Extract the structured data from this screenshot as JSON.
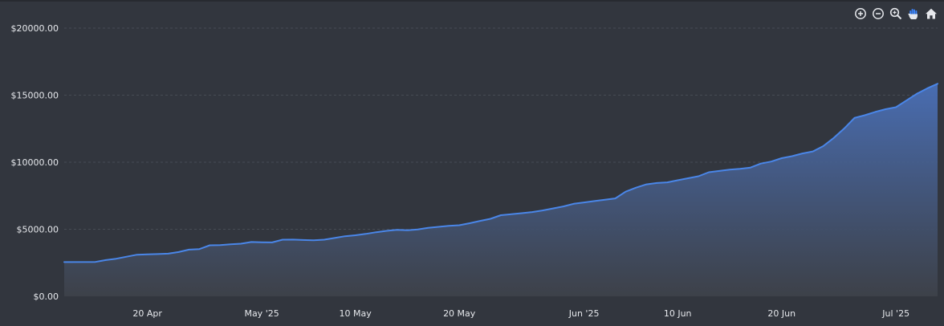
{
  "toolbar": {
    "icons": [
      "zoom-in-icon",
      "zoom-out-icon",
      "zoom-select-icon",
      "pan-hand-icon",
      "reset-home-icon"
    ]
  },
  "colors": {
    "background": "#32363e",
    "line": "#4a86e8",
    "grid": "#474c55",
    "text": "#e6e8ec",
    "active_tool": "#3b82f6"
  },
  "chart_data": {
    "type": "area",
    "title": "",
    "xlabel": "",
    "ylabel": "",
    "grid": true,
    "legend": "none",
    "ylim": [
      0,
      20000
    ],
    "xlim": [
      "2025-04-12",
      "2025-07-05"
    ],
    "y_ticks": [
      {
        "value": 0,
        "label": "$0.00"
      },
      {
        "value": 5000,
        "label": "$5000.00"
      },
      {
        "value": 10000,
        "label": "$10000.00"
      },
      {
        "value": 15000,
        "label": "$15000.00"
      },
      {
        "value": 20000,
        "label": "$20000.00"
      }
    ],
    "x_ticks": [
      {
        "value": "2025-04-20",
        "label": "20 Apr"
      },
      {
        "value": "2025-05-01",
        "label": "May '25"
      },
      {
        "value": "2025-05-10",
        "label": "10 May"
      },
      {
        "value": "2025-05-20",
        "label": "20 May"
      },
      {
        "value": "2025-06-01",
        "label": "Jun '25"
      },
      {
        "value": "2025-06-10",
        "label": "10 Jun"
      },
      {
        "value": "2025-06-20",
        "label": "20 Jun"
      },
      {
        "value": "2025-07-01",
        "label": "Jul '25"
      }
    ],
    "series": [
      {
        "points": [
          [
            "2025-04-12",
            2550
          ],
          [
            "2025-04-15",
            2560
          ],
          [
            "2025-04-16",
            2700
          ],
          [
            "2025-04-17",
            2800
          ],
          [
            "2025-04-18",
            2950
          ],
          [
            "2025-04-19",
            3100
          ],
          [
            "2025-04-20",
            3130
          ],
          [
            "2025-04-21",
            3150
          ],
          [
            "2025-04-22",
            3180
          ],
          [
            "2025-04-23",
            3300
          ],
          [
            "2025-04-24",
            3480
          ],
          [
            "2025-04-25",
            3520
          ],
          [
            "2025-04-26",
            3800
          ],
          [
            "2025-04-27",
            3820
          ],
          [
            "2025-04-28",
            3880
          ],
          [
            "2025-04-29",
            3920
          ],
          [
            "2025-04-30",
            4050
          ],
          [
            "2025-05-01",
            4030
          ],
          [
            "2025-05-02",
            4020
          ],
          [
            "2025-05-03",
            4220
          ],
          [
            "2025-05-04",
            4230
          ],
          [
            "2025-05-05",
            4200
          ],
          [
            "2025-05-06",
            4180
          ],
          [
            "2025-05-07",
            4220
          ],
          [
            "2025-05-08",
            4350
          ],
          [
            "2025-05-09",
            4480
          ],
          [
            "2025-05-10",
            4550
          ],
          [
            "2025-05-11",
            4650
          ],
          [
            "2025-05-12",
            4780
          ],
          [
            "2025-05-13",
            4880
          ],
          [
            "2025-05-14",
            4950
          ],
          [
            "2025-05-15",
            4920
          ],
          [
            "2025-05-16",
            4980
          ],
          [
            "2025-05-17",
            5100
          ],
          [
            "2025-05-18",
            5180
          ],
          [
            "2025-05-19",
            5250
          ],
          [
            "2025-05-20",
            5300
          ],
          [
            "2025-05-21",
            5450
          ],
          [
            "2025-05-22",
            5620
          ],
          [
            "2025-05-23",
            5780
          ],
          [
            "2025-05-24",
            6050
          ],
          [
            "2025-05-25",
            6120
          ],
          [
            "2025-05-26",
            6200
          ],
          [
            "2025-05-27",
            6280
          ],
          [
            "2025-05-28",
            6400
          ],
          [
            "2025-05-29",
            6550
          ],
          [
            "2025-05-30",
            6700
          ],
          [
            "2025-05-31",
            6900
          ],
          [
            "2025-06-01",
            7000
          ],
          [
            "2025-06-02",
            7100
          ],
          [
            "2025-06-03",
            7200
          ],
          [
            "2025-06-04",
            7300
          ],
          [
            "2025-06-05",
            7800
          ],
          [
            "2025-06-06",
            8100
          ],
          [
            "2025-06-07",
            8350
          ],
          [
            "2025-06-08",
            8450
          ],
          [
            "2025-06-09",
            8500
          ],
          [
            "2025-06-10",
            8650
          ],
          [
            "2025-06-11",
            8800
          ],
          [
            "2025-06-12",
            8950
          ],
          [
            "2025-06-13",
            9250
          ],
          [
            "2025-06-14",
            9350
          ],
          [
            "2025-06-15",
            9450
          ],
          [
            "2025-06-16",
            9500
          ],
          [
            "2025-06-17",
            9600
          ],
          [
            "2025-06-18",
            9900
          ],
          [
            "2025-06-19",
            10050
          ],
          [
            "2025-06-20",
            10300
          ],
          [
            "2025-06-21",
            10450
          ],
          [
            "2025-06-22",
            10650
          ],
          [
            "2025-06-23",
            10800
          ],
          [
            "2025-06-24",
            11200
          ],
          [
            "2025-06-25",
            11800
          ],
          [
            "2025-06-26",
            12500
          ],
          [
            "2025-06-27",
            13300
          ],
          [
            "2025-06-28",
            13500
          ],
          [
            "2025-06-29",
            13750
          ],
          [
            "2025-06-30",
            13950
          ],
          [
            "2025-07-01",
            14100
          ],
          [
            "2025-07-02",
            14600
          ],
          [
            "2025-07-03",
            15100
          ],
          [
            "2025-07-04",
            15500
          ],
          [
            "2025-07-05",
            15850
          ]
        ]
      }
    ]
  }
}
